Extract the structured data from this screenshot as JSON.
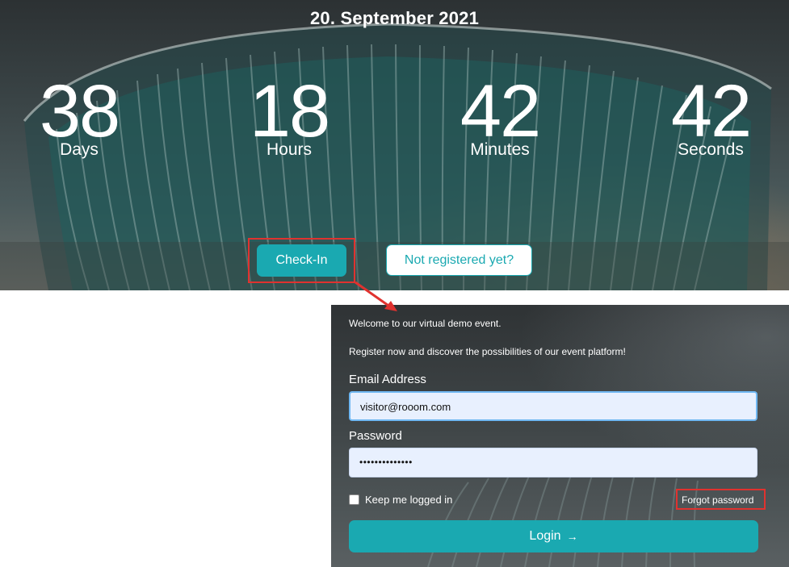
{
  "hero": {
    "date": "20. September 2021",
    "countdown": [
      {
        "value": "38",
        "label": "Days"
      },
      {
        "value": "18",
        "label": "Hours"
      },
      {
        "value": "42",
        "label": "Minutes"
      },
      {
        "value": "42",
        "label": "Seconds"
      }
    ],
    "checkin_label": "Check-In",
    "register_label": "Not registered yet?"
  },
  "login": {
    "welcome": "Welcome to our virtual demo event.",
    "register_text": "Register now and discover the possibilities of our event platform!",
    "email_label": "Email Address",
    "email_value": "visitor@rooom.com",
    "password_label": "Password",
    "password_value": "••••••••••••••",
    "keep_logged_in": "Keep me logged in",
    "forgot_password": "Forgot password",
    "login_button": "Login",
    "login_icon": "arrow-right-icon"
  },
  "colors": {
    "accent": "#1aa9b1",
    "highlight": "#e0322f"
  }
}
